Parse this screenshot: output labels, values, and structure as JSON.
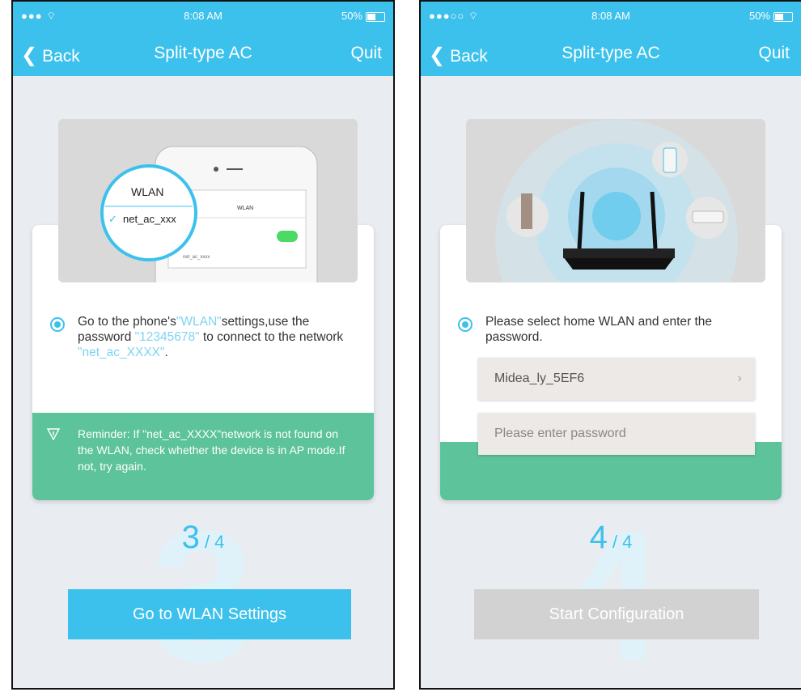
{
  "colors": {
    "accent": "#3cc1ec",
    "green": "#5cc39a",
    "disabled": "#d2d2d2"
  },
  "screen3": {
    "status": {
      "signal": "●●● ⌔",
      "time": "8:08 AM",
      "battery": "50%"
    },
    "nav": {
      "back": "Back",
      "title": "Split-type AC",
      "quit": "Quit"
    },
    "illustration": {
      "wlan_label": "WLAN",
      "network_label": "net_ac_xxx",
      "mini_title": "WLAN",
      "mini_network": "net_ac_xxxx"
    },
    "instruction": {
      "t1": "Go to the phone's",
      "h1": "\"WLAN\"",
      "t2": "settings,use the password",
      "h2": "\"12345678\"",
      "t3": "to connect to the network",
      "h3": "\"net_ac_XXXX\"",
      "t4": "."
    },
    "reminder": "Reminder: If \"net_ac_XXXX\"network is not found on the WLAN, check whether the device is in AP mode.If not, try again.",
    "step": {
      "current": "3",
      "total": "4",
      "watermark": "3"
    },
    "button": "Go to WLAN Settings"
  },
  "screen4": {
    "status": {
      "signal": "●●●○○ ⌔",
      "time": "8:08 AM",
      "battery": "50%"
    },
    "nav": {
      "back": "Back",
      "title": "Split-type AC",
      "quit": "Quit"
    },
    "instruction": "Please select home WLAN and enter the password.",
    "wlan_select": {
      "value": "Midea_ly_5EF6"
    },
    "password": {
      "placeholder": "Please enter password"
    },
    "step": {
      "current": "4",
      "total": "4",
      "watermark": "4"
    },
    "button": "Start Configuration"
  }
}
